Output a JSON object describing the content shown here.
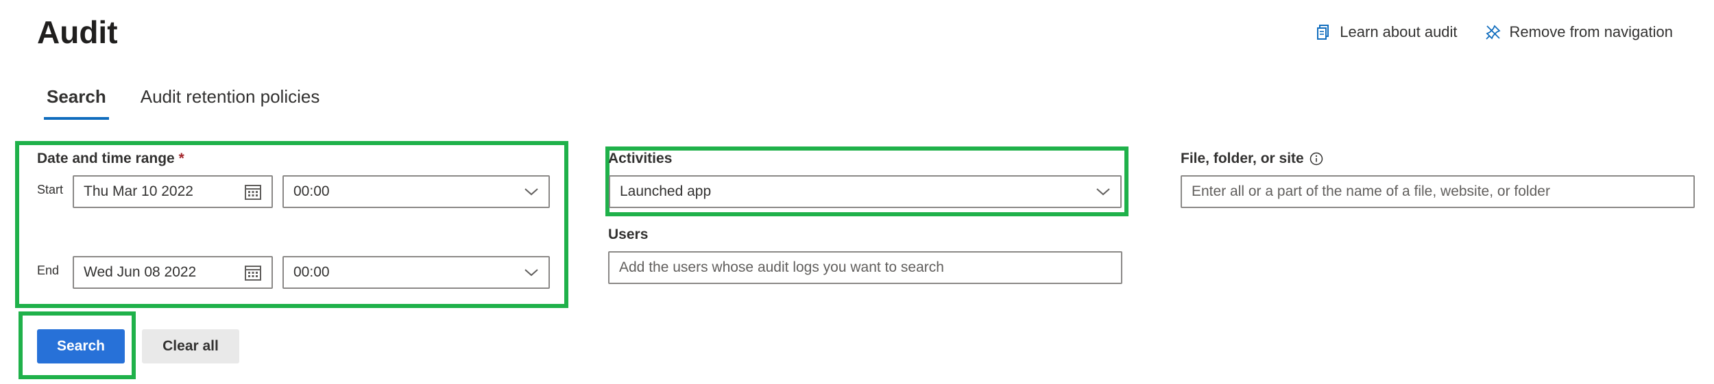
{
  "page": {
    "title": "Audit"
  },
  "header": {
    "learn_label": "Learn about audit",
    "remove_label": "Remove from navigation",
    "accent_color": "#0f6cbd",
    "icons": [
      "document-icon",
      "unpin-icon"
    ]
  },
  "tabs": [
    {
      "label": "Search",
      "active": true
    },
    {
      "label": "Audit retention policies",
      "active": false
    }
  ],
  "date_range": {
    "label": "Date and time range",
    "required_marker": "*",
    "start_label": "Start",
    "start_date": "Thu Mar 10 2022",
    "start_time": "00:00",
    "end_label": "End",
    "end_date": "Wed Jun 08 2022",
    "end_time": "00:00"
  },
  "activities": {
    "label": "Activities",
    "value": "Launched app"
  },
  "users": {
    "label": "Users",
    "placeholder": "Add the users whose audit logs you want to search"
  },
  "file": {
    "label": "File, folder, or site",
    "placeholder": "Enter all or a part of the name of a file, website, or folder"
  },
  "buttons": {
    "search": "Search",
    "clear": "Clear all"
  },
  "highlight_color": "#1fb14a",
  "primary_color": "#2771d8"
}
